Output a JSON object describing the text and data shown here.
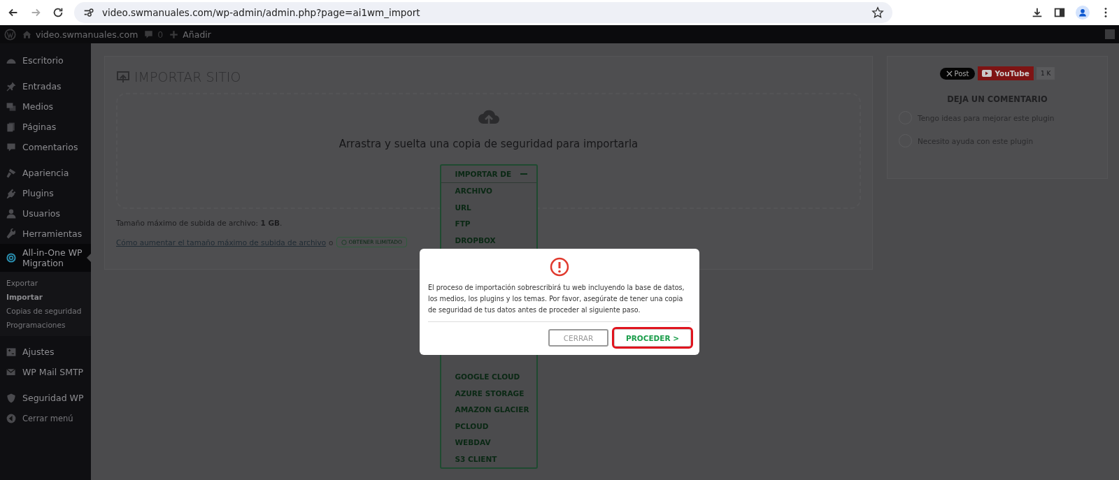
{
  "browser": {
    "url": "video.swmanuales.com/wp-admin/admin.php?page=ai1wm_import"
  },
  "admin_bar": {
    "site_name": "video.swmanuales.com",
    "comments_count": "0",
    "new_label": "Añadir"
  },
  "sidebar": {
    "groups": [
      [
        {
          "label": "Escritorio",
          "selected": false
        }
      ],
      [
        {
          "label": "Entradas",
          "selected": false
        },
        {
          "label": "Medios",
          "selected": false
        },
        {
          "label": "Páginas",
          "selected": false
        },
        {
          "label": "Comentarios",
          "selected": false
        }
      ],
      [
        {
          "label": "Apariencia",
          "selected": false
        },
        {
          "label": "Plugins",
          "selected": false
        },
        {
          "label": "Usuarios",
          "selected": false
        },
        {
          "label": "Herramientas",
          "selected": false
        },
        {
          "label": "All-in-One WP Migration",
          "selected": true,
          "children": [
            {
              "label": "Exportar",
              "selected": false
            },
            {
              "label": "Importar",
              "selected": true
            },
            {
              "label": "Copias de seguridad",
              "selected": false
            },
            {
              "label": "Programaciones",
              "selected": false
            }
          ]
        }
      ],
      [
        {
          "label": "Ajustes",
          "selected": false
        },
        {
          "label": "WP Mail SMTP",
          "selected": false
        }
      ],
      [
        {
          "label": "Seguridad WP",
          "selected": false
        },
        {
          "label": "Cerrar menú",
          "selected": false
        }
      ]
    ]
  },
  "import_panel": {
    "title": "IMPORTAR SITIO",
    "dropzone_text": "Arrastra y suelta una copia de seguridad para importarla",
    "dropdown": {
      "label": "IMPORTAR DE",
      "expanded": true,
      "items_top": [
        "ARCHIVO",
        "URL",
        "FTP",
        "DROPBOX"
      ],
      "items_bottom": [
        "GOOGLE CLOUD",
        "AZURE STORAGE",
        "AMAZON GLACIER",
        "PCLOUD",
        "WEBDAV",
        "S3 CLIENT"
      ]
    },
    "max_size": "Tamaño máximo de subida de archivo: **1 GB**.",
    "help_link": "Cómo aumentar el tamaño máximo de subida de archivo",
    "connector": "o",
    "unlimited_button": "OBTENER ILIMITADO"
  },
  "side_panel": {
    "x_post": "Post",
    "youtube": "YouTube",
    "youtube_count": "1 K",
    "heading": "DEJA UN COMENTARIO",
    "options": [
      {
        "label": "Tengo ideas para mejorar este plugin",
        "selected": false
      },
      {
        "label": "Necesito ayuda con este plugin",
        "selected": false
      }
    ]
  },
  "modal": {
    "message": "El proceso de importación sobrescribirá tu web incluyendo la base de datos, los medios, los plugins y los temas. Por favor, asegúrate de tener una copia de seguridad de tus datos antes de proceder al siguiente paso.",
    "buttons": [
      {
        "label": "CERRAR",
        "kind": "secondary",
        "highlighted": false
      },
      {
        "label": "PROCEDER >",
        "kind": "primary",
        "highlighted": true
      }
    ]
  }
}
